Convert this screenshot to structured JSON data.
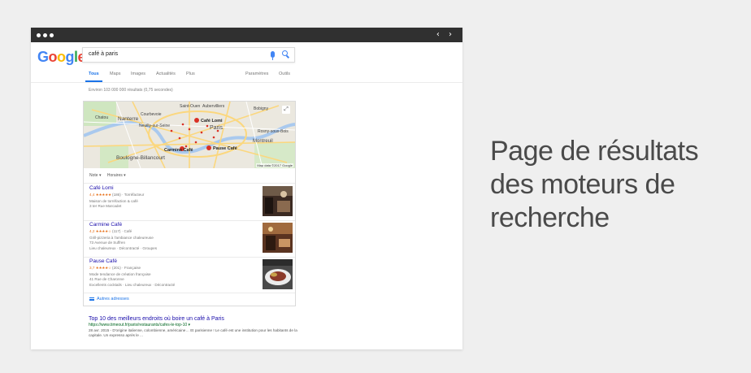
{
  "browser": {
    "nav": "‹ ›"
  },
  "google": {
    "logo_letters": [
      "G",
      "o",
      "o",
      "g",
      "l",
      "e"
    ],
    "logo_colors": [
      "#4285f4",
      "#ea4335",
      "#fbbc05",
      "#4285f4",
      "#34a853",
      "#ea4335"
    ],
    "query": "café à paris",
    "tabs": [
      "Tous",
      "Maps",
      "Images",
      "Actualités",
      "Plus",
      "Paramètres",
      "Outils"
    ],
    "active_tab": "Tous",
    "stats": "Environ 103 000 000 résultats (0,75 secondes)"
  },
  "map": {
    "labels": [
      "Saint-Ouen",
      "Aubervilliers",
      "Bobigny",
      "Chatou",
      "Courbevoie",
      "Nanterre",
      "Neuilly-sur-Seine",
      "Paris",
      "Rosny-sous-Bois",
      "Montreuil",
      "Boulogne-Billancourt"
    ],
    "pins": [
      "Café Lomi",
      "Carmine Café",
      "Pause Café"
    ],
    "credit": "Map data ©2017 Google",
    "expand_icon": "expand-icon"
  },
  "filters": [
    "Note ▾",
    "Horaires ▾"
  ],
  "places": [
    {
      "name": "Café Lomi",
      "rating": "4,4",
      "stars": "★★★★★",
      "reviews": "(186)",
      "category": "Torréfacteur",
      "lines": [
        "Maison de torréfaction & café",
        "3 ter Rue Marcadet"
      ]
    },
    {
      "name": "Carmine Café",
      "rating": "4,2",
      "stars": "★★★★☆",
      "reviews": "(117)",
      "category": "Café",
      "lines": [
        "Grill-pizzeria à l'ambiance chaleureuse",
        "73 Avenue de Suffren",
        "Lieu chaleureux · Décontracté · Groupes"
      ]
    },
    {
      "name": "Pause Café",
      "rating": "3,7",
      "stars": "★★★★☆",
      "reviews": "(201)",
      "category": "Française",
      "lines": [
        "Mode tendance de création française",
        "41 Rue de Charonne",
        "Excellents cocktails · Lieu chaleureux · Décontracté"
      ]
    }
  ],
  "more_places": "Autres adresses",
  "organic": {
    "title": "Top 10 des meilleurs endroits où boire un café à Paris",
    "url": "https://www.timeout.fr/paris/restaurants/cafes-le-top-10 ▾",
    "snippet": "28 avr. 2015 - D'origine italienne, colombienne, américaine… Et parisienne ! Le café est une institution pour les habitants de la capitale. Un expresso après le ..."
  },
  "caption": [
    "Page de résultats",
    "des moteurs de",
    "recherche"
  ]
}
